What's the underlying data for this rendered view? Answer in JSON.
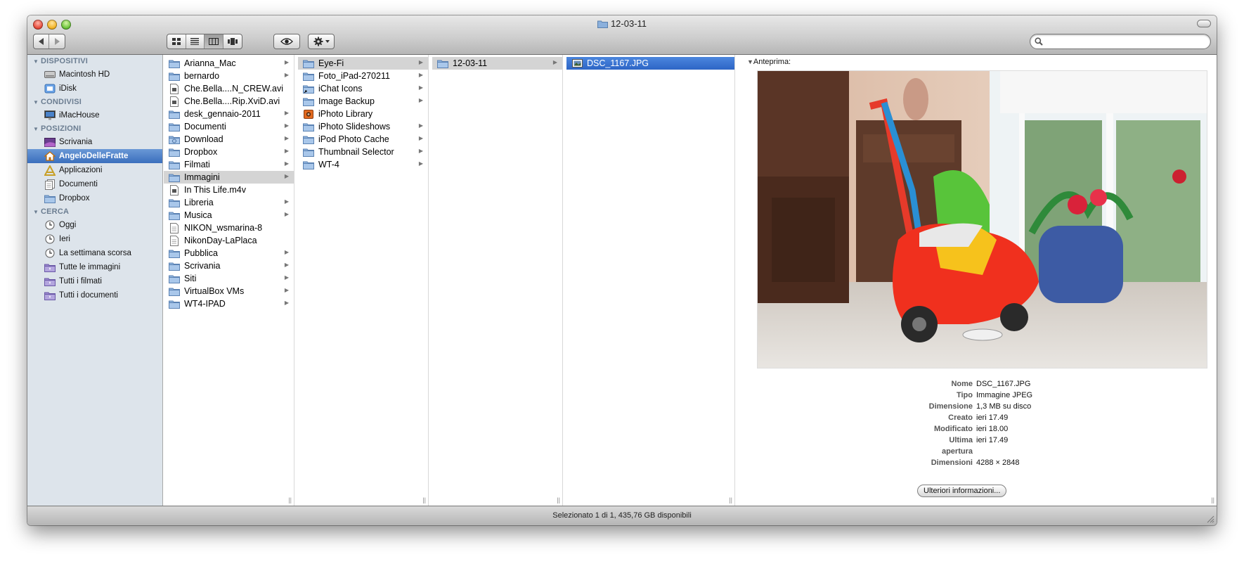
{
  "window": {
    "title": "12-03-11"
  },
  "toolbar": {
    "search_placeholder": ""
  },
  "sidebar": {
    "sections": [
      {
        "title": "DISPOSITIVI",
        "items": [
          {
            "label": "Macintosh HD",
            "icon": "hard-disk-icon"
          },
          {
            "label": "iDisk",
            "icon": "idisk-icon"
          }
        ]
      },
      {
        "title": "CONDIVISI",
        "items": [
          {
            "label": "iMacHouse",
            "icon": "imac-icon"
          }
        ]
      },
      {
        "title": "POSIZIONI",
        "items": [
          {
            "label": "Scrivania",
            "icon": "desktop-icon"
          },
          {
            "label": "AngeloDelleFratte",
            "icon": "home-icon",
            "selected": true
          },
          {
            "label": "Applicazioni",
            "icon": "applications-icon"
          },
          {
            "label": "Documenti",
            "icon": "documents-icon"
          },
          {
            "label": "Dropbox",
            "icon": "folder-icon"
          }
        ]
      },
      {
        "title": "CERCA",
        "items": [
          {
            "label": "Oggi",
            "icon": "clock-icon"
          },
          {
            "label": "Ieri",
            "icon": "clock-icon"
          },
          {
            "label": "La settimana scorsa",
            "icon": "clock-icon"
          },
          {
            "label": "Tutte le immagini",
            "icon": "smart-folder-icon"
          },
          {
            "label": "Tutti i filmati",
            "icon": "smart-folder-icon"
          },
          {
            "label": "Tutti i documenti",
            "icon": "smart-folder-icon"
          }
        ]
      }
    ]
  },
  "columns": [
    {
      "items": [
        {
          "label": "Arianna_Mac",
          "icon": "folder-icon",
          "arrow": true
        },
        {
          "label": "bernardo",
          "icon": "folder-icon",
          "arrow": true
        },
        {
          "label": "Che.Bella....N_CREW.avi",
          "icon": "video-file-icon"
        },
        {
          "label": "Che.Bella....Rip.XviD.avi",
          "icon": "video-file-icon"
        },
        {
          "label": "desk_gennaio-2011",
          "icon": "folder-icon",
          "arrow": true
        },
        {
          "label": "Documenti",
          "icon": "folder-icon",
          "arrow": true
        },
        {
          "label": "Download",
          "icon": "downloads-folder-icon",
          "arrow": true
        },
        {
          "label": "Dropbox",
          "icon": "folder-icon",
          "arrow": true
        },
        {
          "label": "Filmati",
          "icon": "folder-icon",
          "arrow": true
        },
        {
          "label": "Immagini",
          "icon": "folder-icon",
          "arrow": true,
          "state": "path"
        },
        {
          "label": "In This Life.m4v",
          "icon": "video-file-icon"
        },
        {
          "label": "Libreria",
          "icon": "folder-icon",
          "arrow": true
        },
        {
          "label": "Musica",
          "icon": "folder-icon",
          "arrow": true
        },
        {
          "label": "NIKON_wsmarina-8",
          "icon": "document-icon"
        },
        {
          "label": "NikonDay-LaPlaca",
          "icon": "document-icon"
        },
        {
          "label": "Pubblica",
          "icon": "folder-icon",
          "arrow": true
        },
        {
          "label": "Scrivania",
          "icon": "folder-icon",
          "arrow": true
        },
        {
          "label": "Siti",
          "icon": "folder-icon",
          "arrow": true
        },
        {
          "label": "VirtualBox VMs",
          "icon": "folder-icon",
          "arrow": true
        },
        {
          "label": "WT4-IPAD",
          "icon": "folder-icon",
          "arrow": true
        }
      ]
    },
    {
      "items": [
        {
          "label": "Eye-Fi",
          "icon": "folder-icon",
          "arrow": true,
          "state": "path"
        },
        {
          "label": "Foto_iPad-270211",
          "icon": "folder-icon",
          "arrow": true
        },
        {
          "label": "iChat Icons",
          "icon": "alias-folder-icon",
          "arrow": true
        },
        {
          "label": "Image Backup",
          "icon": "folder-icon",
          "arrow": true
        },
        {
          "label": "iPhoto Library",
          "icon": "iphoto-library-icon"
        },
        {
          "label": "iPhoto Slideshows",
          "icon": "folder-icon",
          "arrow": true
        },
        {
          "label": "iPod Photo Cache",
          "icon": "folder-icon",
          "arrow": true
        },
        {
          "label": "Thumbnail Selector",
          "icon": "folder-icon",
          "arrow": true
        },
        {
          "label": "WT-4",
          "icon": "folder-icon",
          "arrow": true
        }
      ]
    },
    {
      "items": [
        {
          "label": "12-03-11",
          "icon": "folder-icon",
          "arrow": true,
          "state": "path"
        }
      ]
    },
    {
      "items": [
        {
          "label": "DSC_1167.JPG",
          "icon": "image-file-icon",
          "state": "selected"
        }
      ]
    }
  ],
  "preview": {
    "heading": "Anteprima:",
    "info": [
      {
        "key": "Nome",
        "value": "DSC_1167.JPG"
      },
      {
        "key": "Tipo",
        "value": "Immagine JPEG"
      },
      {
        "key": "Dimensione",
        "value": "1,3 MB su disco"
      },
      {
        "key": "Creato",
        "value": "ieri 17.49"
      },
      {
        "key": "Modificato",
        "value": "ieri 18.00"
      },
      {
        "key": "Ultima\napertura",
        "value": "ieri 17.49"
      },
      {
        "key": "Dimensioni",
        "value": "4288 × 2848"
      }
    ],
    "more_button": "Ulteriori informazioni..."
  },
  "status": {
    "text": "Selezionato 1 di 1, 435,76 GB disponibili"
  },
  "colors": {
    "sidebar_bg": "#dde4eb",
    "selection": "#3a6fbd",
    "path_highlight": "#d4d4d4"
  }
}
